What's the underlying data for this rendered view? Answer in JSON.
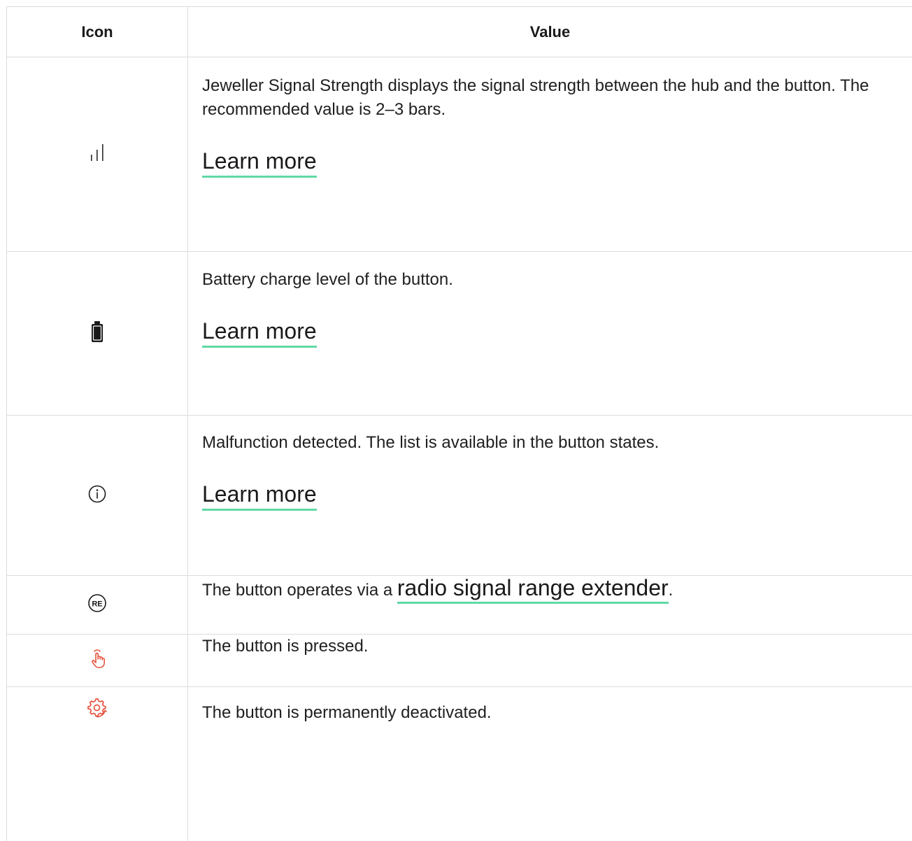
{
  "table": {
    "headers": {
      "icon": "Icon",
      "value": "Value"
    },
    "rows": [
      {
        "icon_name": "signal-strength-icon",
        "text": "Jeweller Signal Strength displays the signal strength between the hub and the button. The recommended value is 2–3 bars.",
        "link": "Learn more"
      },
      {
        "icon_name": "battery-icon",
        "text": "Battery charge level of the button.",
        "link": "Learn more"
      },
      {
        "icon_name": "info-icon",
        "text": "Malfunction detected. The list is available in the button states.",
        "link": "Learn more"
      },
      {
        "icon_name": "range-extender-icon",
        "icon_text": "RE",
        "text_before": "The button operates via a ",
        "link": "radio signal range extender",
        "text_after": "."
      },
      {
        "icon_name": "pressed-hand-icon",
        "text": "The button is pressed."
      },
      {
        "icon_name": "deactivated-gear-icon",
        "text": "The button is permanently deactivated."
      }
    ]
  },
  "colors": {
    "link_underline": "#5fd9a5",
    "alert_icon": "#e8533f",
    "border": "#dcdcdc"
  }
}
